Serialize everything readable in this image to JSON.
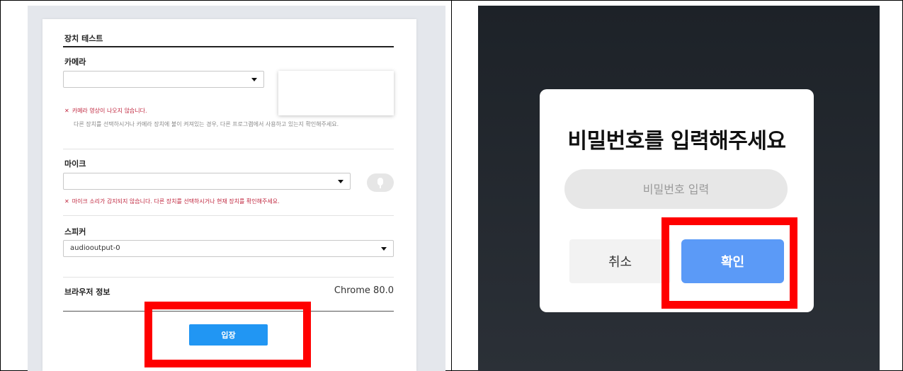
{
  "device_test": {
    "section_title": "장치 테스트",
    "camera": {
      "label": "카메라",
      "selected": "",
      "error": "카메라 영상이 나오지 않습니다.",
      "help": "다른 장치를 선택하시거나 카메라 장치에 불이 켜져있는 경우, 다른 프로그램에서 사용하고 있는지 확인해주세요."
    },
    "mic": {
      "label": "마이크",
      "selected": "",
      "error": "마이크 소리가 감지되지 않습니다. 다른 장치를 선택하시거나 현재 장치를 확인해주세요."
    },
    "speaker": {
      "label": "스피커",
      "selected": "audiooutput-0"
    },
    "browser": {
      "label": "브라우저 정보",
      "value": "Chrome 80.0"
    },
    "enter_label": "입장"
  },
  "password_dialog": {
    "title": "비밀번호를 입력해주세요",
    "placeholder": "비밀번호 입력",
    "cancel_label": "취소",
    "confirm_label": "확인"
  },
  "colors": {
    "accent": "#2196f3",
    "confirm": "#5b9af7",
    "error": "#c0273f",
    "highlight": "#ff0000"
  }
}
